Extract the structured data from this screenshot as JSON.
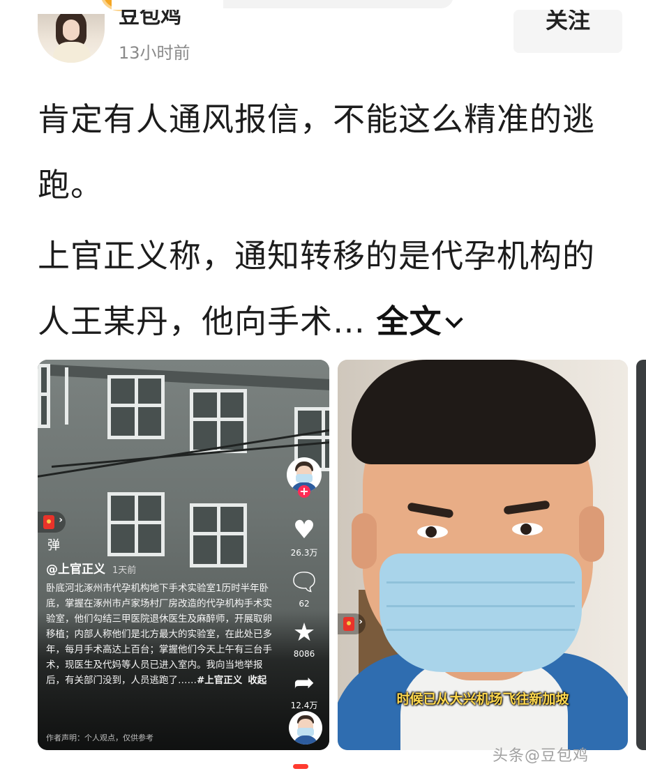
{
  "header": {
    "username": "豆包鸡",
    "timestamp": "13小时前",
    "follow_label": "关注"
  },
  "post": {
    "paragraph1": "肯定有人通风报信，不能这么精准的逃跑。",
    "paragraph2": "上官正义称，通知转移的是代孕机构的人王某丹，他向手术…",
    "expand_label": "全文"
  },
  "video1": {
    "author": "@上官正义",
    "time": "1天前",
    "description": "卧底河北涿州市代孕机构地下手术实验室1历时半年卧底，掌握在涿州市卢家场村厂房改造的代孕机构手术实验室，他们勾结三甲医院退休医生及麻醉师，开展取卵移植；内部人称他们是北方最大的实验室，在此处已多年，每月手术高达上百台；掌握他们今天上午有三台手术，现医生及代妈等人员已进入室内。我向当地举报后，有关部门没到，人员逃跑了……",
    "hashtag": "#上官正义",
    "collapse_label": "收起",
    "disclaimer": "作者声明：个人观点，仅供参考",
    "danmu_label": "弹",
    "likes": "26.3万",
    "comments": "62",
    "favorites": "8086",
    "shares": "12.4万",
    "icons": {
      "like": "heart-icon",
      "comment": "comment-icon",
      "favorite": "star-icon",
      "share": "share-icon"
    }
  },
  "video2": {
    "subtitle": "时候已从大兴机场飞往新加坡"
  },
  "watermark": "头条@豆包鸡",
  "colors": {
    "accent": "#ff2c55",
    "subtitle": "#ffd84d",
    "text": "#1c1c1c",
    "muted": "#8a8a8a"
  }
}
